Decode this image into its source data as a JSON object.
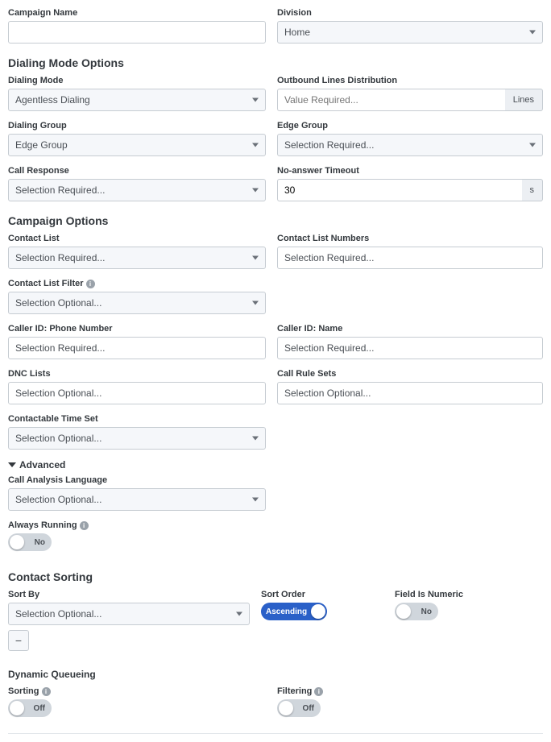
{
  "top": {
    "campaign_name_label": "Campaign Name",
    "division_label": "Division",
    "division_value": "Home"
  },
  "dialing": {
    "title": "Dialing Mode Options",
    "mode_label": "Dialing Mode",
    "mode_value": "Agentless Dialing",
    "lines_label": "Outbound Lines Distribution",
    "lines_placeholder": "Value Required...",
    "lines_addon": "Lines",
    "group_label": "Dialing Group",
    "group_value": "Edge Group",
    "edge_group_label": "Edge Group",
    "edge_group_value": "Selection Required...",
    "call_response_label": "Call Response",
    "call_response_value": "Selection Required...",
    "noanswer_label": "No-answer Timeout",
    "noanswer_value": "30",
    "noanswer_unit": "s"
  },
  "campaign": {
    "title": "Campaign Options",
    "contact_list_label": "Contact List",
    "contact_list_value": "Selection Required...",
    "contact_numbers_label": "Contact List Numbers",
    "contact_numbers_value": "Selection Required...",
    "filter_label": "Contact List Filter",
    "filter_value": "Selection Optional...",
    "caller_phone_label": "Caller ID: Phone Number",
    "caller_phone_value": "Selection Required...",
    "caller_name_label": "Caller ID: Name",
    "caller_name_value": "Selection Required...",
    "dnc_label": "DNC Lists",
    "dnc_value": "Selection Optional...",
    "rulesets_label": "Call Rule Sets",
    "rulesets_value": "Selection Optional...",
    "timeset_label": "Contactable Time Set",
    "timeset_value": "Selection Optional..."
  },
  "advanced": {
    "title": "Advanced",
    "lang_label": "Call Analysis Language",
    "lang_value": "Selection Optional...",
    "always_label": "Always Running",
    "always_state": "No"
  },
  "sorting": {
    "title": "Contact Sorting",
    "sortby_label": "Sort By",
    "sortby_value": "Selection Optional...",
    "order_label": "Sort Order",
    "order_value": "Ascending",
    "numeric_label": "Field Is Numeric",
    "numeric_state": "No"
  },
  "dynq": {
    "title": "Dynamic Queueing",
    "sorting_label": "Sorting",
    "sorting_state": "Off",
    "filtering_label": "Filtering",
    "filtering_state": "Off"
  }
}
